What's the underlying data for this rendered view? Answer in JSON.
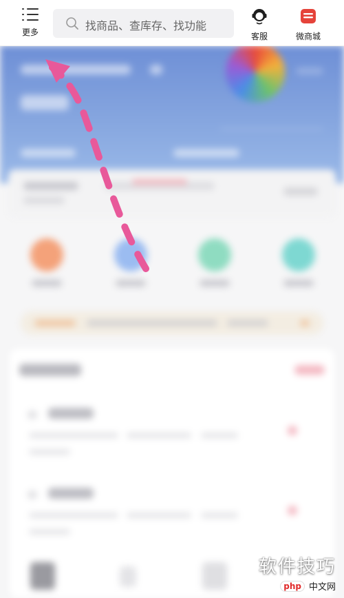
{
  "topbar": {
    "more_label": "更多",
    "search_placeholder": "找商品、查库存、找功能",
    "service_label": "客服",
    "shop_label": "微商城"
  },
  "colors": {
    "brand_red": "#e5433a",
    "arrow_pink": "#e8599a",
    "banner_blue": "#7e9edb"
  },
  "icons": [
    "menu-icon",
    "search-icon",
    "customer-service-icon",
    "micro-mall-icon"
  ],
  "watermark": {
    "line1": "软件技巧",
    "brand": "php",
    "site": "中文网"
  }
}
